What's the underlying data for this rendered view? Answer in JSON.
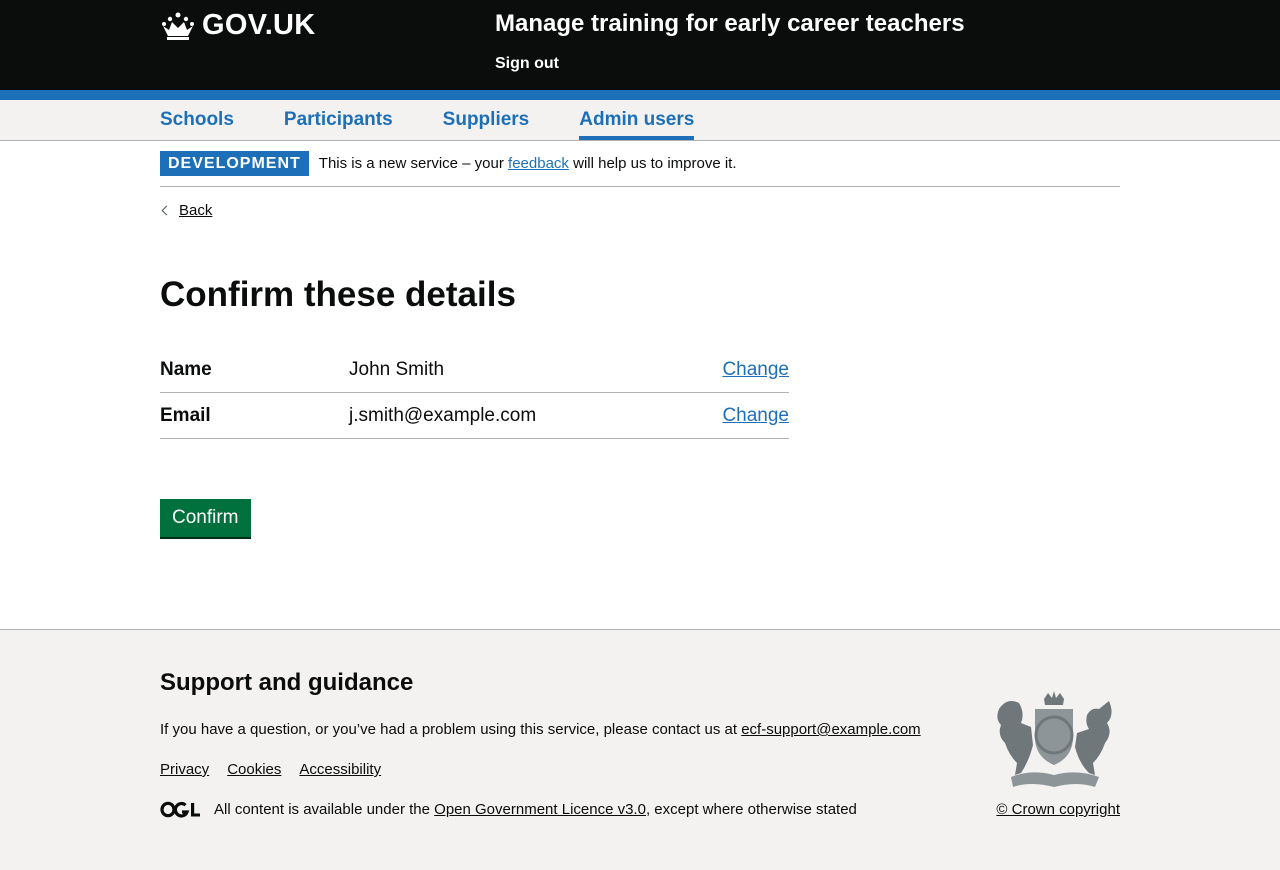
{
  "header": {
    "logo_text": "GOV.UK",
    "service_name": "Manage training for early career teachers",
    "sign_out": "Sign out"
  },
  "nav": {
    "items": [
      {
        "label": "Schools"
      },
      {
        "label": "Participants"
      },
      {
        "label": "Suppliers"
      },
      {
        "label": "Admin users",
        "current": true
      }
    ]
  },
  "phase_banner": {
    "tag": "DEVELOPMENT",
    "text_before": "This is a new service – your",
    "link": "feedback",
    "text_after": "will help us to improve it."
  },
  "back_link": "Back",
  "page_title": "Confirm these details",
  "summary": {
    "rows": [
      {
        "key": "Name",
        "value": "John Smith",
        "action": "Change"
      },
      {
        "key": "Email",
        "value": "j.smith@example.com",
        "action": "Change"
      }
    ]
  },
  "confirm_button": "Confirm",
  "footer": {
    "heading": "Support and guidance",
    "help_text": "If you have a question, or you’ve had a problem using this service, please contact us at",
    "help_email": "ecf-support@example.com",
    "links": [
      "Privacy",
      "Cookies",
      "Accessibility"
    ],
    "licence_before": "All content is available under the",
    "licence_link": "Open Government Licence v3.0",
    "licence_after": ", except where otherwise stated",
    "copyright": "© Crown copyright"
  },
  "colors": {
    "header_bg": "#0b0c0c",
    "brand_blue": "#1d70b8",
    "button_green": "#00703c",
    "footer_bg": "#f3f2f1"
  }
}
